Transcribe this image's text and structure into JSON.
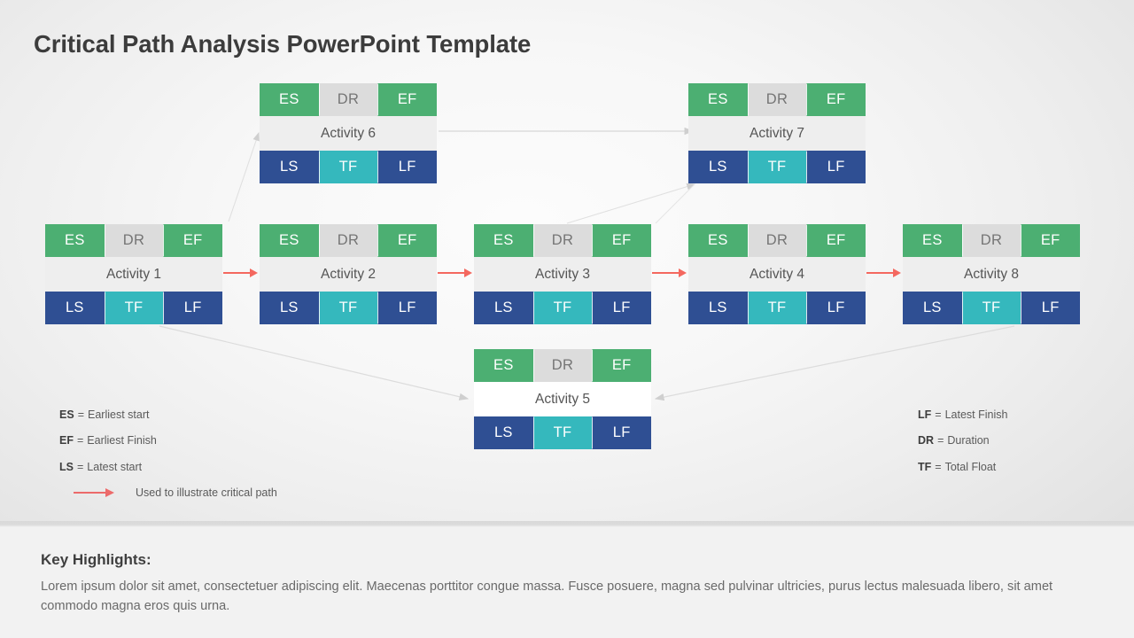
{
  "page_title": "Critical Path Analysis PowerPoint Template",
  "colors": {
    "es_ef": "#4caf72",
    "dr": "#dcdcdc",
    "ls_lf": "#2f4f93",
    "tf": "#35b8bd",
    "critical_arrow": "#f4685f",
    "connector": "#d6d6d6",
    "title_text": "#3c3c3c"
  },
  "cell_labels": {
    "es": "ES",
    "dr": "DR",
    "ef": "EF",
    "ls": "LS",
    "tf": "TF",
    "lf": "LF"
  },
  "nodes": [
    {
      "id": "activity-6",
      "label": "Activity 6"
    },
    {
      "id": "activity-7",
      "label": "Activity 7"
    },
    {
      "id": "activity-1",
      "label": "Activity 1"
    },
    {
      "id": "activity-2",
      "label": "Activity 2"
    },
    {
      "id": "activity-3",
      "label": "Activity 3"
    },
    {
      "id": "activity-4",
      "label": "Activity 4"
    },
    {
      "id": "activity-8",
      "label": "Activity 8"
    },
    {
      "id": "activity-5",
      "label": "Activity 5"
    }
  ],
  "legend_left": [
    {
      "abbr": "ES",
      "text": "Earliest  start"
    },
    {
      "abbr": "EF",
      "text": "Earliest  Finish"
    },
    {
      "abbr": "LS",
      "text": "Latest start"
    }
  ],
  "legend_arrow_text": "Used to  illustrate  critical  path",
  "legend_right": [
    {
      "abbr": "LF",
      "text": "Latest Finish"
    },
    {
      "abbr": "DR",
      "text": "Duration"
    },
    {
      "abbr": "TF",
      "text": "Total Float"
    }
  ],
  "legend_equals": "=",
  "highlights": {
    "title": "Key Highlights:",
    "body": "Lorem  ipsum dolor sit amet, consectetuer adipiscing elit. Maecenas porttitor congue massa. Fusce posuere, magna sed pulvinar ultricies, purus lectus malesuada libero, sit amet commodo magna  eros quis urna."
  }
}
